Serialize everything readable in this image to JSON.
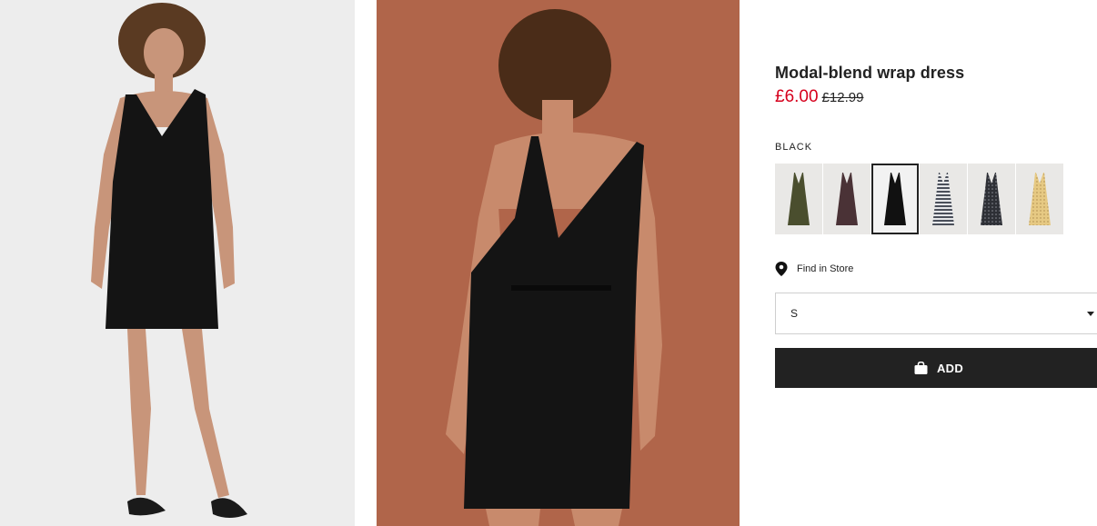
{
  "product": {
    "title": "Modal-blend wrap dress",
    "price_sale": "£6.00",
    "price_original": "£12.99"
  },
  "color": {
    "selected_label": "BLACK",
    "swatches": [
      {
        "name": "khaki-green",
        "color": "#4a4e2e",
        "selected": false
      },
      {
        "name": "dark-burgundy",
        "color": "#4a3236",
        "selected": false
      },
      {
        "name": "black",
        "color": "#111111",
        "selected": true
      },
      {
        "name": "white-striped",
        "color": "#9ea3ab",
        "selected": false
      },
      {
        "name": "dark-grey-patterned",
        "color": "#3a3c42",
        "selected": false
      },
      {
        "name": "yellow-patterned",
        "color": "#e2c57e",
        "selected": false
      }
    ]
  },
  "store": {
    "find_in_store_label": "Find in Store",
    "icon": "location-pin-icon"
  },
  "size": {
    "selected_value": "S"
  },
  "cart": {
    "add_label": "ADD",
    "icon": "shopping-bag-icon"
  },
  "colors": {
    "sale_red": "#d6001c",
    "button_black": "#222222",
    "back_photo_bg": "#b0654a",
    "front_photo_bg": "#ededed"
  }
}
